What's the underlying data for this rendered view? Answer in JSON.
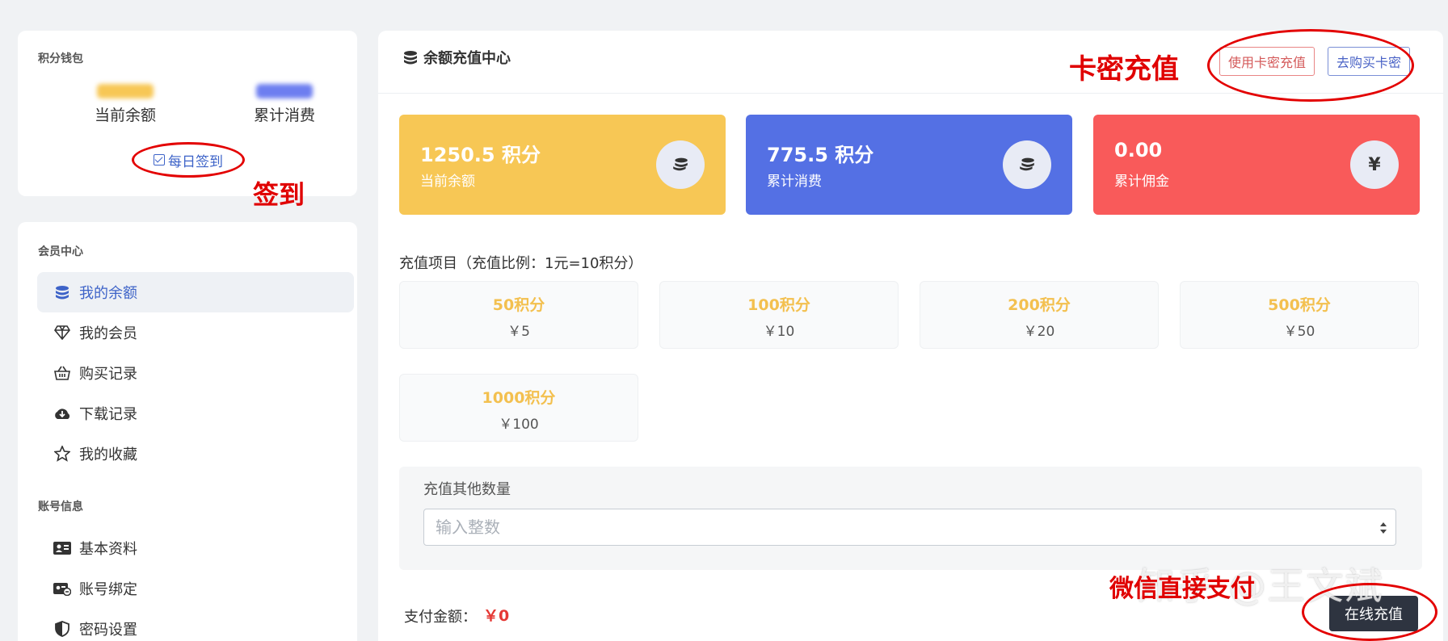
{
  "wallet": {
    "title": "积分钱包",
    "balance_label": "当前余额",
    "spent_label": "累计消费",
    "checkin_label": "每日签到"
  },
  "annotations": {
    "checkin": "签到",
    "card_recharge": "卡密充值",
    "wechat_pay": "微信直接支付"
  },
  "member": {
    "title": "会员中心",
    "items": [
      {
        "label": "我的余额",
        "icon": "coins-icon",
        "active": true
      },
      {
        "label": "我的会员",
        "icon": "diamond-icon"
      },
      {
        "label": "购买记录",
        "icon": "basket-icon"
      },
      {
        "label": "下载记录",
        "icon": "cloud-download-icon"
      },
      {
        "label": "我的收藏",
        "icon": "star-icon"
      }
    ],
    "account_title": "账号信息",
    "account_items": [
      {
        "label": "基本资料",
        "icon": "id-card-icon"
      },
      {
        "label": "账号绑定",
        "icon": "bind-icon"
      },
      {
        "label": "密码设置",
        "icon": "shield-icon"
      }
    ]
  },
  "main": {
    "title": "余额充值中心",
    "btn_card": "使用卡密充值",
    "btn_buy": "去购买卡密",
    "stats": [
      {
        "value": "1250.5 积分",
        "label": "当前余额",
        "color": "#f7c755",
        "icon": "coins-icon"
      },
      {
        "value": "775.5 积分",
        "label": "累计消费",
        "color": "#5470e4",
        "icon": "coins-icon"
      },
      {
        "value": "0.00",
        "label": "累计佣金",
        "color": "#f95a5a",
        "icon": "yen-icon",
        "icon_text": "¥"
      }
    ],
    "project_title": "充值项目（充值比例：1元=10积分）",
    "packages": [
      {
        "points": "50积分",
        "price": "￥5"
      },
      {
        "points": "100积分",
        "price": "￥10"
      },
      {
        "points": "200积分",
        "price": "￥20"
      },
      {
        "points": "500积分",
        "price": "￥50"
      },
      {
        "points": "1000积分",
        "price": "￥100"
      }
    ],
    "other_label": "充值其他数量",
    "other_placeholder": "输入整数",
    "pay_label": "支付金额：",
    "pay_amount": "￥0",
    "pay_button": "在线充值"
  },
  "watermark": "知乎 @王文斌"
}
